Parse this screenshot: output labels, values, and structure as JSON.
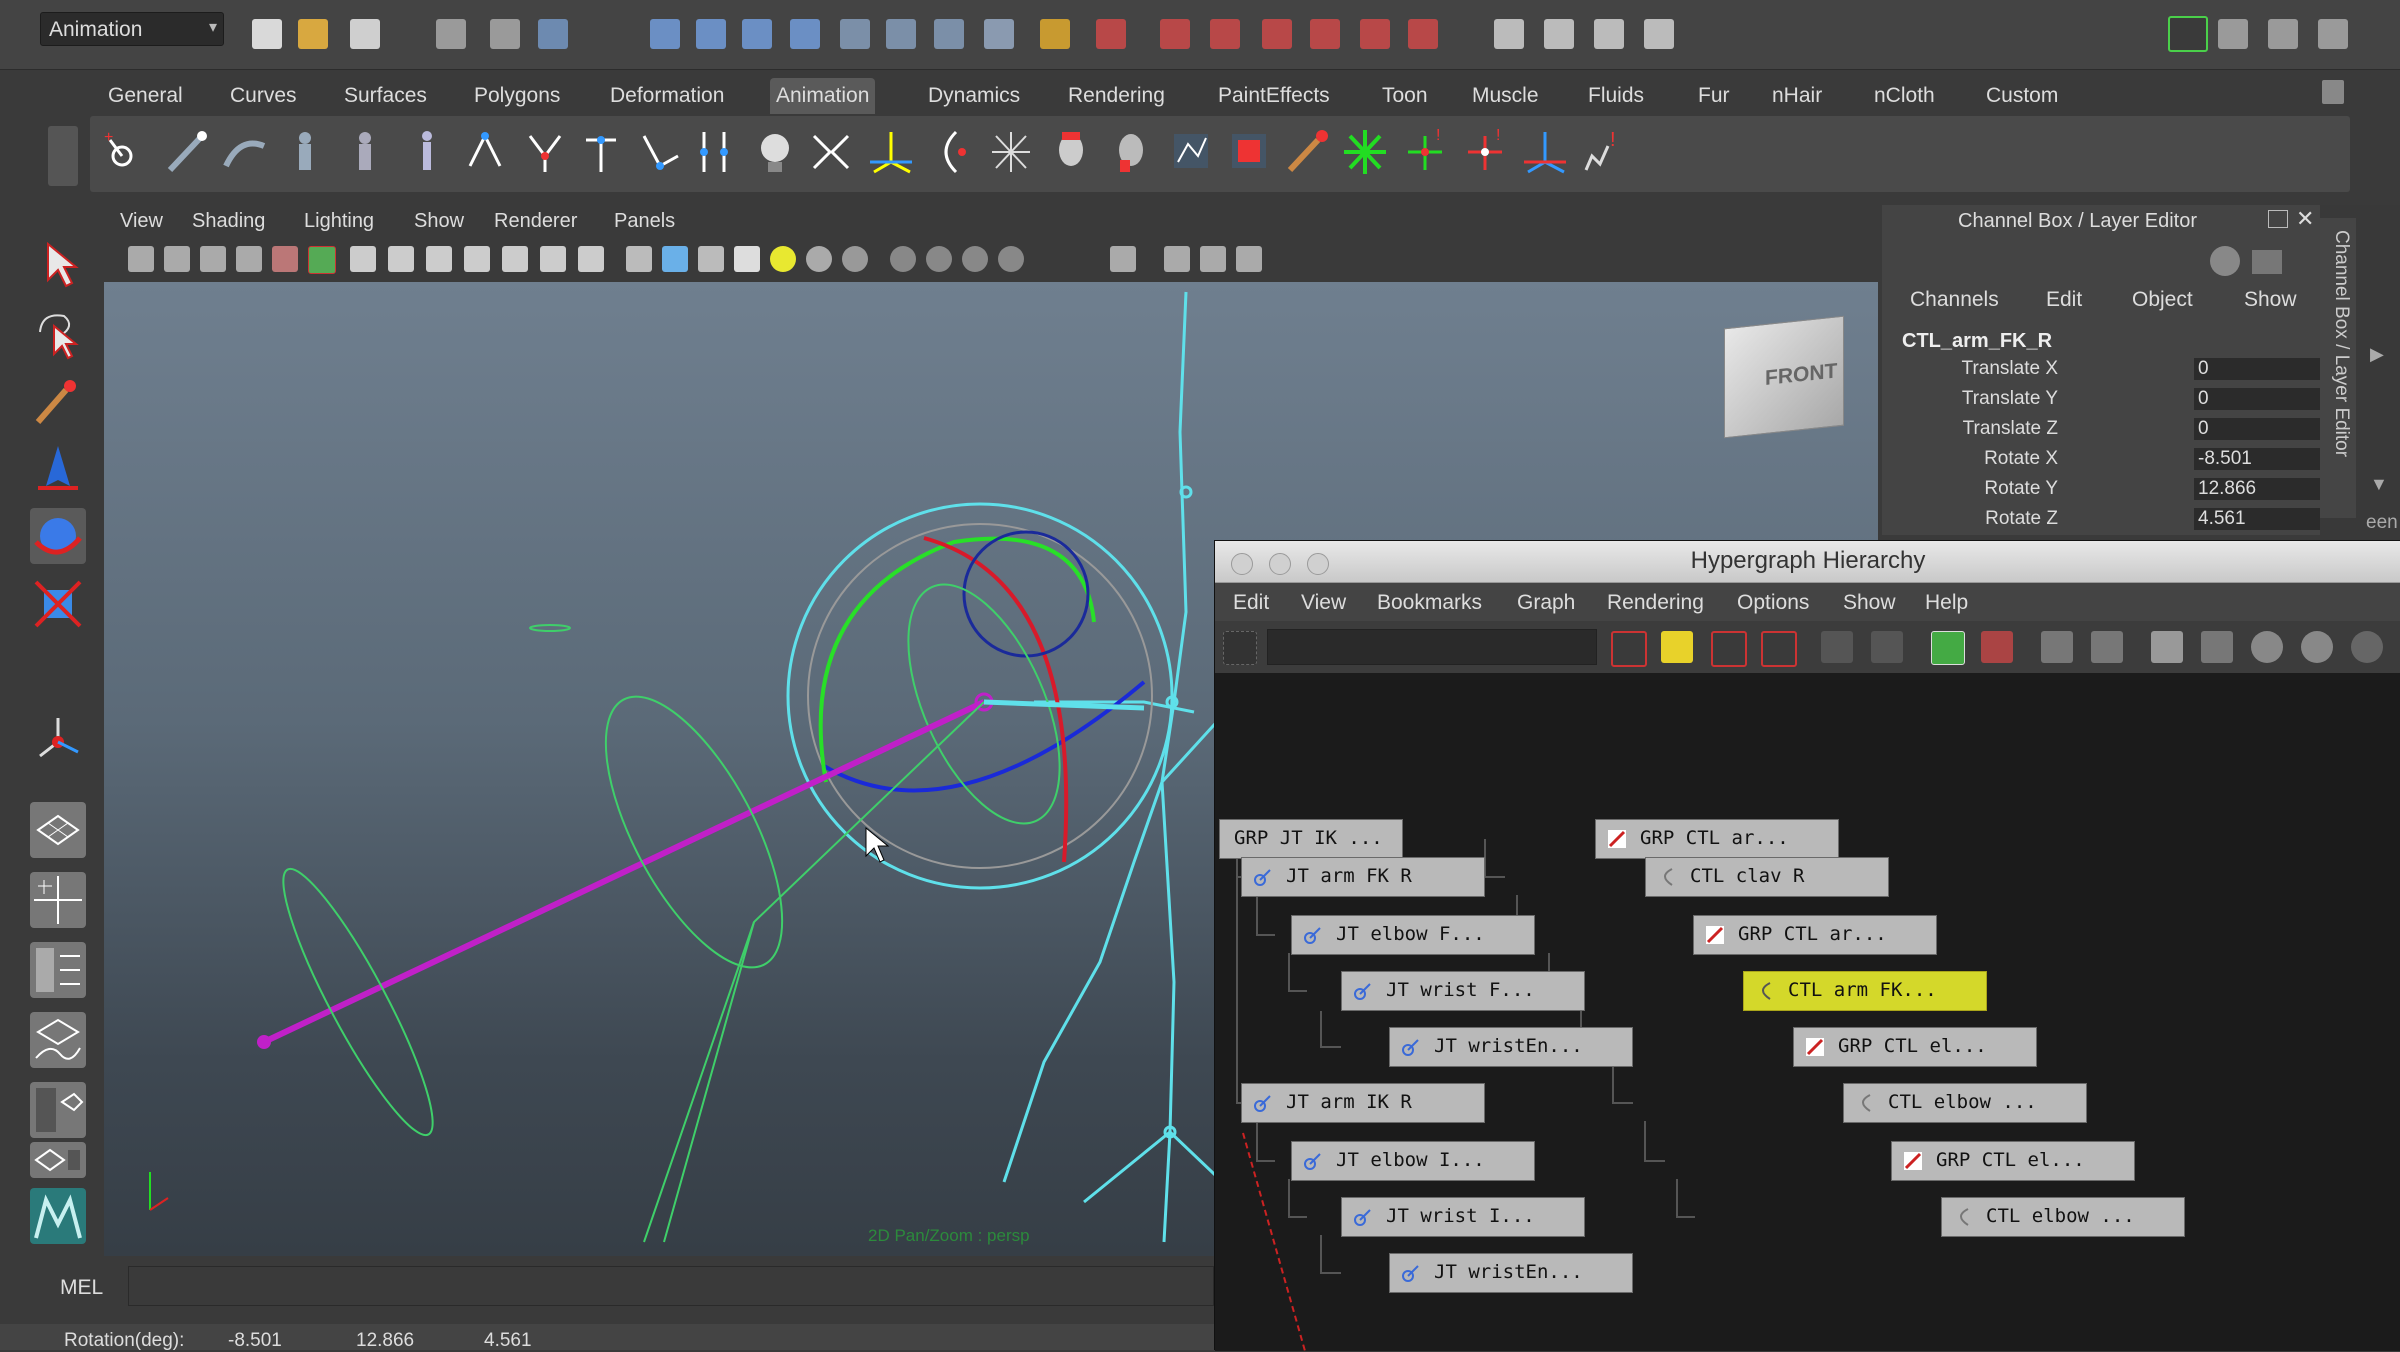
{
  "status_line": {
    "mode": "Animation"
  },
  "shelf": {
    "tabs": [
      "General",
      "Curves",
      "Surfaces",
      "Polygons",
      "Deformation",
      "Animation",
      "Dynamics",
      "Rendering",
      "PaintEffects",
      "Toon",
      "Muscle",
      "Fluids",
      "Fur",
      "nHair",
      "nCloth",
      "Custom"
    ],
    "active_tab": "Animation"
  },
  "viewport": {
    "menu": [
      "View",
      "Shading",
      "Lighting",
      "Show",
      "Renderer",
      "Panels"
    ],
    "view_cube_label": "FRONT",
    "hud_message": "2D Pan/Zoom : persp"
  },
  "channel_box": {
    "title": "Channel Box / Layer Editor",
    "menu": [
      "Channels",
      "Edit",
      "Object",
      "Show"
    ],
    "object_name": "CTL_arm_FK_R",
    "attributes": [
      {
        "label": "Translate X",
        "value": "0"
      },
      {
        "label": "Translate Y",
        "value": "0"
      },
      {
        "label": "Translate Z",
        "value": "0"
      },
      {
        "label": "Rotate X",
        "value": "-8.501"
      },
      {
        "label": "Rotate Y",
        "value": "12.866"
      },
      {
        "label": "Rotate Z",
        "value": "4.561"
      }
    ],
    "vertical_tab": "Channel Box / Layer Editor",
    "side_text": "een"
  },
  "hypergraph": {
    "title": "Hypergraph Hierarchy",
    "menu": [
      "Edit",
      "View",
      "Bookmarks",
      "Graph",
      "Rendering",
      "Options",
      "Show",
      "Help"
    ],
    "nodes": [
      {
        "label": "GRP JT IK ...",
        "icon": "none",
        "selected": false
      },
      {
        "label": "JT arm FK R",
        "icon": "joint",
        "selected": false
      },
      {
        "label": "JT elbow F...",
        "icon": "joint",
        "selected": false
      },
      {
        "label": "JT wrist F...",
        "icon": "joint",
        "selected": false
      },
      {
        "label": "JT wristEn...",
        "icon": "joint",
        "selected": false
      },
      {
        "label": "JT arm IK R",
        "icon": "joint",
        "selected": false
      },
      {
        "label": "JT elbow I...",
        "icon": "joint",
        "selected": false
      },
      {
        "label": "JT wrist I...",
        "icon": "joint",
        "selected": false
      },
      {
        "label": "JT wristEn...",
        "icon": "joint",
        "selected": false
      },
      {
        "label": "GRP CTL ar...",
        "icon": "group",
        "selected": false
      },
      {
        "label": "CTL clav R",
        "icon": "curve",
        "selected": false
      },
      {
        "label": "GRP CTL ar...",
        "icon": "group",
        "selected": false
      },
      {
        "label": "CTL arm FK...",
        "icon": "curve",
        "selected": true
      },
      {
        "label": "GRP CTL el...",
        "icon": "group",
        "selected": false
      },
      {
        "label": "CTL elbow ...",
        "icon": "curve",
        "selected": false
      },
      {
        "label": "GRP CTL el...",
        "icon": "group",
        "selected": false
      },
      {
        "label": "CTL elbow ...",
        "icon": "curve",
        "selected": false
      }
    ]
  },
  "command_line": {
    "label": "MEL"
  },
  "help_line": {
    "label": "Rotation(deg):",
    "x": "-8.501",
    "y": "12.866",
    "z": "4.561"
  },
  "colors": {
    "bg": "#3a3a3a",
    "selected_node": "#d4d82a",
    "skeleton_cyan": "#5fe0ea",
    "ik_magenta": "#c020c8"
  }
}
